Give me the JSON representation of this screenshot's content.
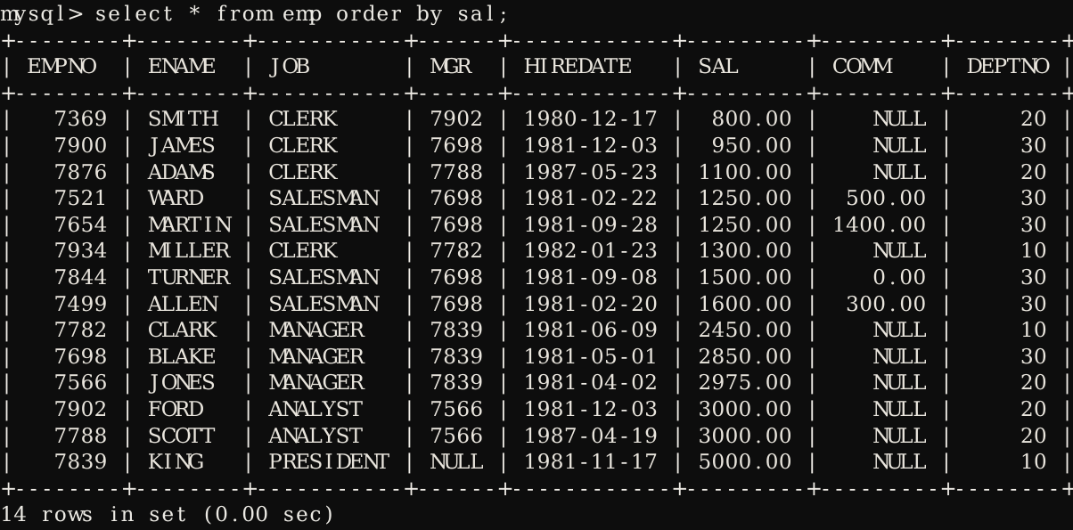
{
  "terminal": {
    "title": "mysql client",
    "background_color": "#0d0d0d",
    "foreground_color": "#e9e5dd",
    "prompt": "mysql>",
    "command": "select * from emp order by sal;",
    "prompt_line": "mysql> select * from emp order by sal;",
    "status_line": "14 rows in set (0.00 sec)",
    "row_count": 14,
    "elapsed": "0.00 sec"
  },
  "table": {
    "name": "emp",
    "columns": [
      {
        "name": "EMPNO",
        "width": 8,
        "align": "right"
      },
      {
        "name": "ENAME",
        "width": 8,
        "align": "left"
      },
      {
        "name": "JOB",
        "width": 11,
        "align": "left"
      },
      {
        "name": "MGR",
        "width": 6,
        "align": "right"
      },
      {
        "name": "HIREDATE",
        "width": 12,
        "align": "left"
      },
      {
        "name": "SAL",
        "width": 9,
        "align": "right"
      },
      {
        "name": "COMM",
        "width": 9,
        "align": "right"
      },
      {
        "name": "DEPTNO",
        "width": 8,
        "align": "right"
      }
    ],
    "rows": [
      {
        "EMPNO": "7369",
        "ENAME": "SMITH",
        "JOB": "CLERK",
        "MGR": "7902",
        "HIREDATE": "1980-12-17",
        "SAL": "800.00",
        "COMM": "NULL",
        "DEPTNO": "20"
      },
      {
        "EMPNO": "7900",
        "ENAME": "JAMES",
        "JOB": "CLERK",
        "MGR": "7698",
        "HIREDATE": "1981-12-03",
        "SAL": "950.00",
        "COMM": "NULL",
        "DEPTNO": "30"
      },
      {
        "EMPNO": "7876",
        "ENAME": "ADAMS",
        "JOB": "CLERK",
        "MGR": "7788",
        "HIREDATE": "1987-05-23",
        "SAL": "1100.00",
        "COMM": "NULL",
        "DEPTNO": "20"
      },
      {
        "EMPNO": "7521",
        "ENAME": "WARD",
        "JOB": "SALESMAN",
        "MGR": "7698",
        "HIREDATE": "1981-02-22",
        "SAL": "1250.00",
        "COMM": "500.00",
        "DEPTNO": "30"
      },
      {
        "EMPNO": "7654",
        "ENAME": "MARTIN",
        "JOB": "SALESMAN",
        "MGR": "7698",
        "HIREDATE": "1981-09-28",
        "SAL": "1250.00",
        "COMM": "1400.00",
        "DEPTNO": "30"
      },
      {
        "EMPNO": "7934",
        "ENAME": "MILLER",
        "JOB": "CLERK",
        "MGR": "7782",
        "HIREDATE": "1982-01-23",
        "SAL": "1300.00",
        "COMM": "NULL",
        "DEPTNO": "10"
      },
      {
        "EMPNO": "7844",
        "ENAME": "TURNER",
        "JOB": "SALESMAN",
        "MGR": "7698",
        "HIREDATE": "1981-09-08",
        "SAL": "1500.00",
        "COMM": "0.00",
        "DEPTNO": "30"
      },
      {
        "EMPNO": "7499",
        "ENAME": "ALLEN",
        "JOB": "SALESMAN",
        "MGR": "7698",
        "HIREDATE": "1981-02-20",
        "SAL": "1600.00",
        "COMM": "300.00",
        "DEPTNO": "30"
      },
      {
        "EMPNO": "7782",
        "ENAME": "CLARK",
        "JOB": "MANAGER",
        "MGR": "7839",
        "HIREDATE": "1981-06-09",
        "SAL": "2450.00",
        "COMM": "NULL",
        "DEPTNO": "10"
      },
      {
        "EMPNO": "7698",
        "ENAME": "BLAKE",
        "JOB": "MANAGER",
        "MGR": "7839",
        "HIREDATE": "1981-05-01",
        "SAL": "2850.00",
        "COMM": "NULL",
        "DEPTNO": "30"
      },
      {
        "EMPNO": "7566",
        "ENAME": "JONES",
        "JOB": "MANAGER",
        "MGR": "7839",
        "HIREDATE": "1981-04-02",
        "SAL": "2975.00",
        "COMM": "NULL",
        "DEPTNO": "20"
      },
      {
        "EMPNO": "7902",
        "ENAME": "FORD",
        "JOB": "ANALYST",
        "MGR": "7566",
        "HIREDATE": "1981-12-03",
        "SAL": "3000.00",
        "COMM": "NULL",
        "DEPTNO": "20"
      },
      {
        "EMPNO": "7788",
        "ENAME": "SCOTT",
        "JOB": "ANALYST",
        "MGR": "7566",
        "HIREDATE": "1987-04-19",
        "SAL": "3000.00",
        "COMM": "NULL",
        "DEPTNO": "20"
      },
      {
        "EMPNO": "7839",
        "ENAME": "KING",
        "JOB": "PRESIDENT",
        "MGR": "NULL",
        "HIREDATE": "1981-11-17",
        "SAL": "5000.00",
        "COMM": "NULL",
        "DEPTNO": "10"
      }
    ]
  }
}
